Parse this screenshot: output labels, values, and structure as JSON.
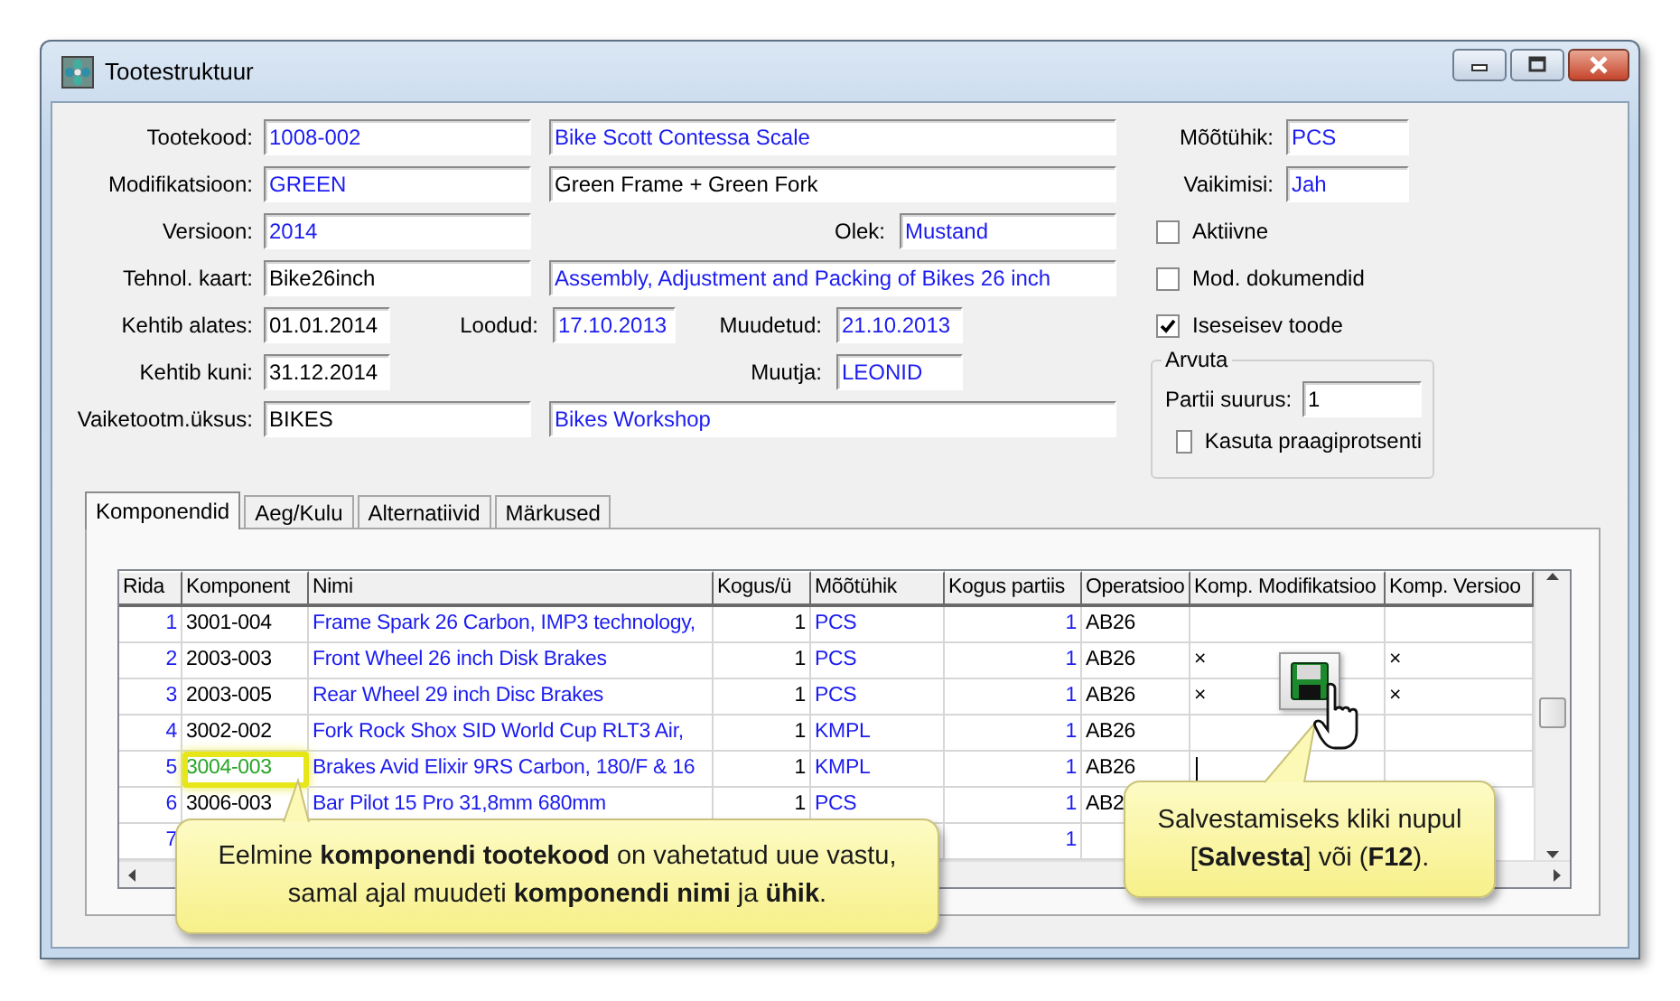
{
  "window": {
    "title": "Tootestruktuur"
  },
  "form": {
    "fields": [
      {
        "label": "Tootekood:",
        "value": "1008-002",
        "linked": true
      },
      {
        "value": "Bike Scott Contessa Scale",
        "linked": true
      },
      {
        "label": "Modifikatsioon:",
        "value": "GREEN",
        "linked": true
      },
      {
        "value": "Green Frame + Green Fork",
        "linked": false
      },
      {
        "label": "Versioon:",
        "value": "2014",
        "linked": true
      },
      {
        "label": "Olek:",
        "value": "Mustand",
        "linked": true
      },
      {
        "label": "Tehnol. kaart:",
        "value": "Bike26inch",
        "linked": false
      },
      {
        "value": "Assembly, Adjustment and Packing of Bikes 26 inch",
        "linked": true
      },
      {
        "label": "Kehtib alates:",
        "value": "01.01.2014",
        "linked": false
      },
      {
        "label": "Loodud:",
        "value": "17.10.2013",
        "linked": true
      },
      {
        "label": "Muudetud:",
        "value": "21.10.2013",
        "linked": true
      },
      {
        "label": "Kehtib kuni:",
        "value": "31.12.2014",
        "linked": false
      },
      {
        "label": "Muutja:",
        "value": "LEONID",
        "linked": true
      },
      {
        "label": "Vaiketootm.üksus:",
        "value": "BIKES",
        "linked": false
      },
      {
        "value": "Bikes Workshop",
        "linked": true
      }
    ]
  },
  "side": {
    "fields": [
      {
        "label": "Mõõtühik:",
        "value": "PCS",
        "linked": true
      },
      {
        "label": "Vaikimisi:",
        "value": "Jah",
        "linked": true
      }
    ],
    "checks": [
      {
        "label": "Aktiivne",
        "checked": false
      },
      {
        "label": "Mod. dokumendid",
        "checked": false
      },
      {
        "label": "Iseseisev toode",
        "checked": true
      }
    ],
    "group": {
      "title": "Arvuta",
      "field": {
        "label": "Partii suurus:",
        "value": "1",
        "linked": false
      },
      "check": {
        "label": "Kasuta praagiprotsenti",
        "checked": false
      }
    }
  },
  "tabs": [
    {
      "label": "Komponendid",
      "selected": true
    },
    {
      "label": "Aeg/Kulu",
      "selected": false
    },
    {
      "label": "Alternatiivid",
      "selected": false
    },
    {
      "label": "Märkused",
      "selected": false
    }
  ],
  "grid": {
    "columns": [
      {
        "label": "Rida",
        "linked": true
      },
      {
        "label": "Komponent",
        "linked": false
      },
      {
        "label": "Nimi",
        "linked": true
      },
      {
        "label": "Kogus/ü",
        "linked": false
      },
      {
        "label": "Mõõtühik",
        "linked": true
      },
      {
        "label": "Kogus partiis",
        "linked": true
      },
      {
        "label": "Operatsioo",
        "linked": false
      },
      {
        "label": "Komp. Modifikatsioo",
        "linked": false
      },
      {
        "label": "Komp. Versioo",
        "linked": false
      }
    ],
    "rows": [
      {
        "cells": [
          "1",
          "3001-004",
          "Frame Spark 26 Carbon, IMP3 technology,",
          "1",
          "PCS",
          "1",
          "AB26",
          null,
          null
        ],
        "changed": false,
        "editing": false
      },
      {
        "cells": [
          "2",
          "2003-003",
          "Front Wheel 26 inch Disk Brakes",
          "1",
          "PCS",
          "1",
          "AB26",
          "×",
          "×"
        ],
        "changed": false,
        "editing": false
      },
      {
        "cells": [
          "3",
          "2003-005",
          "Rear Wheel 29 inch Disc Brakes",
          "1",
          "PCS",
          "1",
          "AB26",
          "×",
          "×"
        ],
        "changed": false,
        "editing": false
      },
      {
        "cells": [
          "4",
          "3002-002",
          "Fork Rock Shox SID World Cup RLT3 Air,",
          "1",
          "KMPL",
          "1",
          "AB26",
          null,
          null
        ],
        "changed": false,
        "editing": false
      },
      {
        "cells": [
          "5",
          "3004-003",
          "Brakes Avid Elixir 9RS Carbon, 180/F & 16",
          "1",
          "KMPL",
          "1",
          "AB26",
          null,
          null
        ],
        "changed": true,
        "editing": true
      },
      {
        "cells": [
          "6",
          "3006-003",
          "Bar Pilot 15 Pro 31,8mm 680mm",
          "1",
          "PCS",
          "1",
          "AB2",
          null,
          null
        ],
        "changed": false
      },
      {
        "cells": [
          "7",
          null,
          null,
          null,
          null,
          "1",
          null,
          null,
          null
        ]
      }
    ]
  },
  "callouts": [
    {
      "text": "Eelmine **komponendi tootekood** on vahetatud uue vastu, samal ajal muudeti **komponendi nimi** ja **ühik**."
    },
    {
      "text": "Salvestamiseks kliki nupul [**Salvesta**] või (**F12**)."
    }
  ]
}
